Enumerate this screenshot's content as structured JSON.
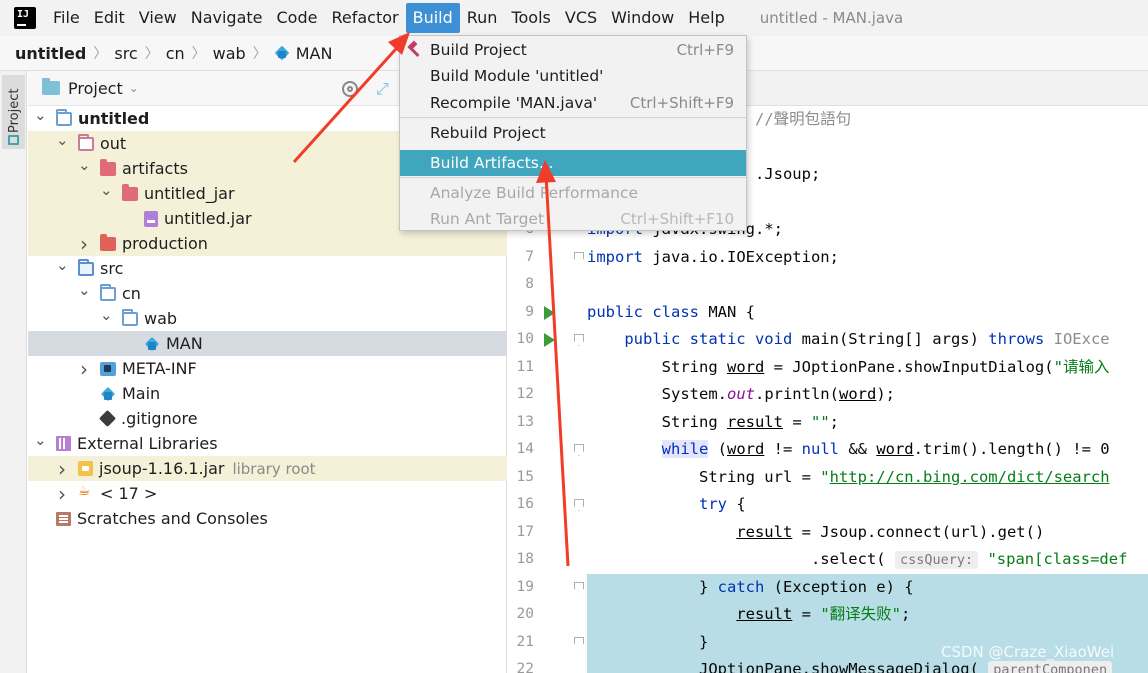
{
  "menubar": {
    "items": [
      "File",
      "Edit",
      "View",
      "Navigate",
      "Code",
      "Refactor",
      "Build",
      "Run",
      "Tools",
      "VCS",
      "Window",
      "Help"
    ],
    "active": "Build",
    "window_title": "untitled - MAN.java"
  },
  "breadcrumb": [
    "untitled",
    "src",
    "cn",
    "wab",
    "MAN"
  ],
  "tool_strip": {
    "project_label": "Project"
  },
  "project_panel": {
    "title": "Project",
    "tree": [
      {
        "label": "untitled",
        "sub": "",
        "indent": 0,
        "chev": "down",
        "icon": "folder-blue",
        "bold": true,
        "hl": ""
      },
      {
        "label": "out",
        "sub": "",
        "indent": 1,
        "chev": "down",
        "icon": "folder-pink",
        "bold": false,
        "hl": "yellow"
      },
      {
        "label": "artifacts",
        "sub": "",
        "indent": 2,
        "chev": "down",
        "icon": "folder-red",
        "bold": false,
        "hl": "yellow"
      },
      {
        "label": "untitled_jar",
        "sub": "",
        "indent": 3,
        "chev": "down",
        "icon": "folder-red",
        "bold": false,
        "hl": "yellow"
      },
      {
        "label": "untitled.jar",
        "sub": "",
        "indent": 4,
        "chev": "none",
        "icon": "jar",
        "bold": false,
        "hl": "yellow"
      },
      {
        "label": "production",
        "sub": "",
        "indent": 2,
        "chev": "right",
        "icon": "folder-orange",
        "bold": false,
        "hl": "yellow"
      },
      {
        "label": "src",
        "sub": "",
        "indent": 1,
        "chev": "down",
        "icon": "folder-src",
        "bold": false,
        "hl": ""
      },
      {
        "label": "cn",
        "sub": "",
        "indent": 2,
        "chev": "down",
        "icon": "folder-blue",
        "bold": false,
        "hl": ""
      },
      {
        "label": "wab",
        "sub": "",
        "indent": 3,
        "chev": "down",
        "icon": "folder-blue",
        "bold": false,
        "hl": ""
      },
      {
        "label": "MAN",
        "sub": "",
        "indent": 4,
        "chev": "none",
        "icon": "cube",
        "bold": false,
        "hl": "sel"
      },
      {
        "label": "META-INF",
        "sub": "",
        "indent": 2,
        "chev": "right",
        "icon": "folder-meta",
        "bold": false,
        "hl": ""
      },
      {
        "label": "Main",
        "sub": "",
        "indent": 2,
        "chev": "none",
        "icon": "cube",
        "bold": false,
        "hl": ""
      },
      {
        "label": ".gitignore",
        "sub": "",
        "indent": 2,
        "chev": "none",
        "icon": "git",
        "bold": false,
        "hl": ""
      },
      {
        "label": "External Libraries",
        "sub": "",
        "indent": 0,
        "chev": "down",
        "icon": "lib",
        "bold": false,
        "hl": ""
      },
      {
        "label": "jsoup-1.16.1.jar",
        "sub": "library root",
        "indent": 1,
        "chev": "right",
        "icon": "jarlib",
        "bold": false,
        "hl": "yellow"
      },
      {
        "label": "< 17 >",
        "sub": "",
        "indent": 1,
        "chev": "right",
        "icon": "java",
        "bold": false,
        "hl": ""
      },
      {
        "label": "Scratches and Consoles",
        "sub": "",
        "indent": 0,
        "chev": "none",
        "icon": "scratch",
        "bold": false,
        "hl": ""
      }
    ]
  },
  "build_menu": {
    "items": [
      {
        "label": "Build Project",
        "shortcut": "Ctrl+F9",
        "state": "normal",
        "icon": "hammer-icon"
      },
      {
        "label": "Build Module 'untitled'",
        "shortcut": "",
        "state": "normal",
        "icon": ""
      },
      {
        "label": "Recompile 'MAN.java'",
        "shortcut": "Ctrl+Shift+F9",
        "state": "normal",
        "icon": ""
      },
      {
        "label": "Rebuild Project",
        "shortcut": "",
        "state": "normal",
        "icon": ""
      },
      {
        "label": "Build Artifacts...",
        "shortcut": "",
        "state": "hover",
        "icon": ""
      },
      {
        "label": "Analyze Build Performance",
        "shortcut": "",
        "state": "disabled",
        "icon": ""
      },
      {
        "label": "Run Ant Target",
        "shortcut": "Ctrl+Shift+F10",
        "state": "disabled",
        "icon": ""
      }
    ]
  },
  "editor": {
    "lines": [
      {
        "n": "",
        "html": "<span class=\"cm\">//聲明包語句</span>",
        "indent": "                  ",
        "sel": false,
        "run": false,
        "fold": false
      },
      {
        "n": "",
        "html": "",
        "indent": "",
        "sel": false,
        "run": false,
        "fold": false
      },
      {
        "n": "",
        "html": ".Jsoup;",
        "indent": "                  ",
        "sel": false,
        "run": false,
        "fold": false
      },
      {
        "n": "",
        "html": "",
        "indent": "",
        "sel": false,
        "run": false,
        "fold": false
      },
      {
        "n": "6",
        "html": "<span class=\"kw\">import</span> javax.swing.*;",
        "indent": "",
        "sel": false,
        "run": false,
        "fold": false
      },
      {
        "n": "7",
        "html": "<span class=\"kw\">import</span> java.io.IOException;",
        "indent": "",
        "sel": false,
        "run": false,
        "fold": true
      },
      {
        "n": "8",
        "html": "",
        "indent": "",
        "sel": false,
        "run": false,
        "fold": false
      },
      {
        "n": "9",
        "html": "<span class=\"kw\">public class</span> MAN {",
        "indent": "",
        "sel": false,
        "run": true,
        "fold": false
      },
      {
        "n": "10",
        "html": "    <span class=\"kw\">public static void</span> main(String[] args) <span class=\"kw\">throws</span> <span class=\"cm\">IOExce</span>",
        "indent": "",
        "sel": false,
        "run": true,
        "fold": true
      },
      {
        "n": "11",
        "html": "        String <span class=\"var\">word</span> = JOptionPane.showInputDialog(<span class=\"str\">\"请输入</span>",
        "indent": "",
        "sel": false,
        "run": false,
        "fold": false
      },
      {
        "n": "12",
        "html": "        System.<span class=\"it\">out</span>.println(<span class=\"var\">word</span>);",
        "indent": "",
        "sel": false,
        "run": false,
        "fold": false
      },
      {
        "n": "13",
        "html": "        String <span class=\"var\">result</span> = <span class=\"str\">\"\"</span>;",
        "indent": "",
        "sel": false,
        "run": false,
        "fold": false
      },
      {
        "n": "14",
        "html": "        <span class=\"while-kw\">while</span> (<span class=\"var\">word</span> != <span class=\"kw\">null</span> &amp;&amp; <span class=\"var\">word</span>.trim().length() != 0",
        "indent": "",
        "sel": false,
        "run": false,
        "fold": true
      },
      {
        "n": "15",
        "html": "            String url = <span class=\"str\">\"<span class=\"ul\">http://cn.bing.com/dict/search</span></span>",
        "indent": "",
        "sel": false,
        "run": false,
        "fold": false
      },
      {
        "n": "16",
        "html": "            <span class=\"kw\">try</span> {",
        "indent": "",
        "sel": false,
        "run": false,
        "fold": true
      },
      {
        "n": "17",
        "html": "                <span class=\"var\">result</span> = Jsoup.connect(url).get()",
        "indent": "",
        "sel": false,
        "run": false,
        "fold": false
      },
      {
        "n": "18",
        "html": "                        .select( <span class=\"hint\">cssQuery:</span> <span class=\"str\">\"span[class=def</span>",
        "indent": "",
        "sel": false,
        "run": false,
        "fold": false
      },
      {
        "n": "19",
        "html": "            } <span class=\"kw\">catch</span> (Exception e) {",
        "indent": "",
        "sel": true,
        "run": false,
        "fold": true
      },
      {
        "n": "20",
        "html": "                <span class=\"var\">result</span> = <span class=\"str\">\"翻译失败\"</span>;",
        "indent": "",
        "sel": true,
        "run": false,
        "fold": false
      },
      {
        "n": "21",
        "html": "            }",
        "indent": "",
        "sel": true,
        "run": false,
        "fold": true
      },
      {
        "n": "22",
        "html": "            JOptionPane.showMessageDialog( <span class=\"hint\">parentComponen</span>",
        "indent": "",
        "sel": true,
        "run": false,
        "fold": false
      }
    ]
  },
  "watermark": "CSDN @Craze_XiaoWei",
  "colors": {
    "accent": "#3d8fd6",
    "menu_hover": "#3fa6bd",
    "annotation_arrow": "#f03d2a",
    "selection": "#b9dde6"
  }
}
